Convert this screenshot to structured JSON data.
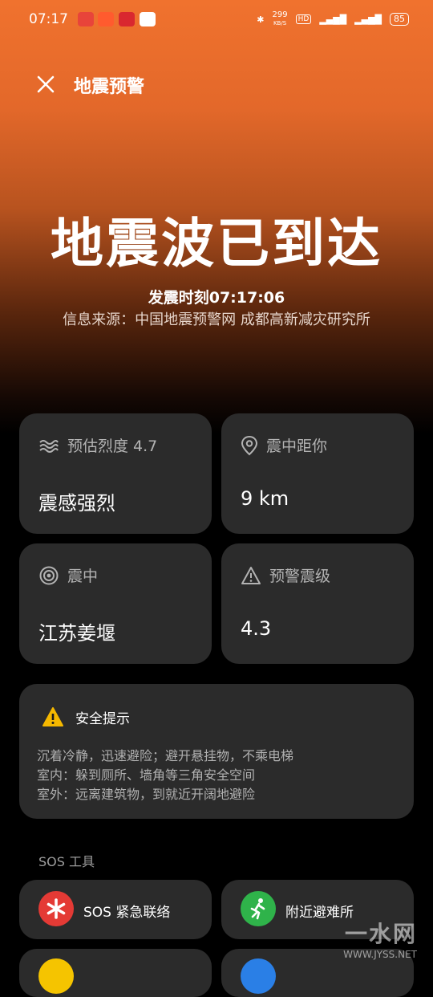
{
  "status_bar": {
    "time": "07:17",
    "net_speed": "299",
    "net_unit": "KB/S",
    "battery": "85"
  },
  "header": {
    "title": "地震预警"
  },
  "hero": {
    "title": "地震波已到达",
    "time_line": "发震时刻07:17:06",
    "source_line": "信息来源：中国地震预警网 成都高新减灾研究所"
  },
  "cards": {
    "intensity": {
      "label": "预估烈度 4.7",
      "value": "震感强烈",
      "icon": "waves-icon"
    },
    "distance": {
      "label": "震中距你",
      "value": "9 km",
      "icon": "location-pin-icon"
    },
    "epicenter": {
      "label": "震中",
      "value": "江苏姜堰",
      "icon": "target-icon"
    },
    "magnitude": {
      "label": "预警震级",
      "value": "4.3",
      "icon": "warning-triangle-icon"
    }
  },
  "safety": {
    "title": "安全提示",
    "lines": [
      "沉着冷静，迅速避险；避开悬挂物，不乘电梯",
      "室内：躲到厕所、墙角等三角安全空间",
      "室外：远离建筑物，到就近开阔地避险"
    ]
  },
  "sos": {
    "label": "SOS 工具",
    "emergency": "SOS 紧急联络",
    "shelter": "附近避难所"
  },
  "watermark": {
    "main": "一水网",
    "sub": "WWW.JYSS.NET"
  },
  "colors": {
    "accent_orange": "#f0722e",
    "card_bg": "#2b2b2b",
    "sos_red": "#e43a35",
    "shelter_green": "#2fb34a"
  }
}
